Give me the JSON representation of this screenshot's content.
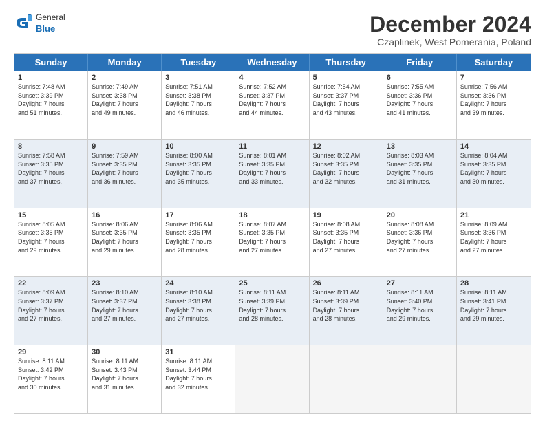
{
  "logo": {
    "general": "General",
    "blue": "Blue"
  },
  "title": "December 2024",
  "subtitle": "Czaplinek, West Pomerania, Poland",
  "header_days": [
    "Sunday",
    "Monday",
    "Tuesday",
    "Wednesday",
    "Thursday",
    "Friday",
    "Saturday"
  ],
  "rows": [
    {
      "alt": false,
      "cells": [
        {
          "day": "1",
          "sunrise": "Sunrise: 7:48 AM",
          "sunset": "Sunset: 3:39 PM",
          "daylight": "Daylight: 7 hours",
          "minutes": "and 51 minutes."
        },
        {
          "day": "2",
          "sunrise": "Sunrise: 7:49 AM",
          "sunset": "Sunset: 3:38 PM",
          "daylight": "Daylight: 7 hours",
          "minutes": "and 49 minutes."
        },
        {
          "day": "3",
          "sunrise": "Sunrise: 7:51 AM",
          "sunset": "Sunset: 3:38 PM",
          "daylight": "Daylight: 7 hours",
          "minutes": "and 46 minutes."
        },
        {
          "day": "4",
          "sunrise": "Sunrise: 7:52 AM",
          "sunset": "Sunset: 3:37 PM",
          "daylight": "Daylight: 7 hours",
          "minutes": "and 44 minutes."
        },
        {
          "day": "5",
          "sunrise": "Sunrise: 7:54 AM",
          "sunset": "Sunset: 3:37 PM",
          "daylight": "Daylight: 7 hours",
          "minutes": "and 43 minutes."
        },
        {
          "day": "6",
          "sunrise": "Sunrise: 7:55 AM",
          "sunset": "Sunset: 3:36 PM",
          "daylight": "Daylight: 7 hours",
          "minutes": "and 41 minutes."
        },
        {
          "day": "7",
          "sunrise": "Sunrise: 7:56 AM",
          "sunset": "Sunset: 3:36 PM",
          "daylight": "Daylight: 7 hours",
          "minutes": "and 39 minutes."
        }
      ]
    },
    {
      "alt": true,
      "cells": [
        {
          "day": "8",
          "sunrise": "Sunrise: 7:58 AM",
          "sunset": "Sunset: 3:35 PM",
          "daylight": "Daylight: 7 hours",
          "minutes": "and 37 minutes."
        },
        {
          "day": "9",
          "sunrise": "Sunrise: 7:59 AM",
          "sunset": "Sunset: 3:35 PM",
          "daylight": "Daylight: 7 hours",
          "minutes": "and 36 minutes."
        },
        {
          "day": "10",
          "sunrise": "Sunrise: 8:00 AM",
          "sunset": "Sunset: 3:35 PM",
          "daylight": "Daylight: 7 hours",
          "minutes": "and 35 minutes."
        },
        {
          "day": "11",
          "sunrise": "Sunrise: 8:01 AM",
          "sunset": "Sunset: 3:35 PM",
          "daylight": "Daylight: 7 hours",
          "minutes": "and 33 minutes."
        },
        {
          "day": "12",
          "sunrise": "Sunrise: 8:02 AM",
          "sunset": "Sunset: 3:35 PM",
          "daylight": "Daylight: 7 hours",
          "minutes": "and 32 minutes."
        },
        {
          "day": "13",
          "sunrise": "Sunrise: 8:03 AM",
          "sunset": "Sunset: 3:35 PM",
          "daylight": "Daylight: 7 hours",
          "minutes": "and 31 minutes."
        },
        {
          "day": "14",
          "sunrise": "Sunrise: 8:04 AM",
          "sunset": "Sunset: 3:35 PM",
          "daylight": "Daylight: 7 hours",
          "minutes": "and 30 minutes."
        }
      ]
    },
    {
      "alt": false,
      "cells": [
        {
          "day": "15",
          "sunrise": "Sunrise: 8:05 AM",
          "sunset": "Sunset: 3:35 PM",
          "daylight": "Daylight: 7 hours",
          "minutes": "and 29 minutes."
        },
        {
          "day": "16",
          "sunrise": "Sunrise: 8:06 AM",
          "sunset": "Sunset: 3:35 PM",
          "daylight": "Daylight: 7 hours",
          "minutes": "and 29 minutes."
        },
        {
          "day": "17",
          "sunrise": "Sunrise: 8:06 AM",
          "sunset": "Sunset: 3:35 PM",
          "daylight": "Daylight: 7 hours",
          "minutes": "and 28 minutes."
        },
        {
          "day": "18",
          "sunrise": "Sunrise: 8:07 AM",
          "sunset": "Sunset: 3:35 PM",
          "daylight": "Daylight: 7 hours",
          "minutes": "and 27 minutes."
        },
        {
          "day": "19",
          "sunrise": "Sunrise: 8:08 AM",
          "sunset": "Sunset: 3:35 PM",
          "daylight": "Daylight: 7 hours",
          "minutes": "and 27 minutes."
        },
        {
          "day": "20",
          "sunrise": "Sunrise: 8:08 AM",
          "sunset": "Sunset: 3:36 PM",
          "daylight": "Daylight: 7 hours",
          "minutes": "and 27 minutes."
        },
        {
          "day": "21",
          "sunrise": "Sunrise: 8:09 AM",
          "sunset": "Sunset: 3:36 PM",
          "daylight": "Daylight: 7 hours",
          "minutes": "and 27 minutes."
        }
      ]
    },
    {
      "alt": true,
      "cells": [
        {
          "day": "22",
          "sunrise": "Sunrise: 8:09 AM",
          "sunset": "Sunset: 3:37 PM",
          "daylight": "Daylight: 7 hours",
          "minutes": "and 27 minutes."
        },
        {
          "day": "23",
          "sunrise": "Sunrise: 8:10 AM",
          "sunset": "Sunset: 3:37 PM",
          "daylight": "Daylight: 7 hours",
          "minutes": "and 27 minutes."
        },
        {
          "day": "24",
          "sunrise": "Sunrise: 8:10 AM",
          "sunset": "Sunset: 3:38 PM",
          "daylight": "Daylight: 7 hours",
          "minutes": "and 27 minutes."
        },
        {
          "day": "25",
          "sunrise": "Sunrise: 8:11 AM",
          "sunset": "Sunset: 3:39 PM",
          "daylight": "Daylight: 7 hours",
          "minutes": "and 28 minutes."
        },
        {
          "day": "26",
          "sunrise": "Sunrise: 8:11 AM",
          "sunset": "Sunset: 3:39 PM",
          "daylight": "Daylight: 7 hours",
          "minutes": "and 28 minutes."
        },
        {
          "day": "27",
          "sunrise": "Sunrise: 8:11 AM",
          "sunset": "Sunset: 3:40 PM",
          "daylight": "Daylight: 7 hours",
          "minutes": "and 29 minutes."
        },
        {
          "day": "28",
          "sunrise": "Sunrise: 8:11 AM",
          "sunset": "Sunset: 3:41 PM",
          "daylight": "Daylight: 7 hours",
          "minutes": "and 29 minutes."
        }
      ]
    },
    {
      "alt": false,
      "cells": [
        {
          "day": "29",
          "sunrise": "Sunrise: 8:11 AM",
          "sunset": "Sunset: 3:42 PM",
          "daylight": "Daylight: 7 hours",
          "minutes": "and 30 minutes."
        },
        {
          "day": "30",
          "sunrise": "Sunrise: 8:11 AM",
          "sunset": "Sunset: 3:43 PM",
          "daylight": "Daylight: 7 hours",
          "minutes": "and 31 minutes."
        },
        {
          "day": "31",
          "sunrise": "Sunrise: 8:11 AM",
          "sunset": "Sunset: 3:44 PM",
          "daylight": "Daylight: 7 hours",
          "minutes": "and 32 minutes."
        },
        null,
        null,
        null,
        null
      ]
    }
  ]
}
